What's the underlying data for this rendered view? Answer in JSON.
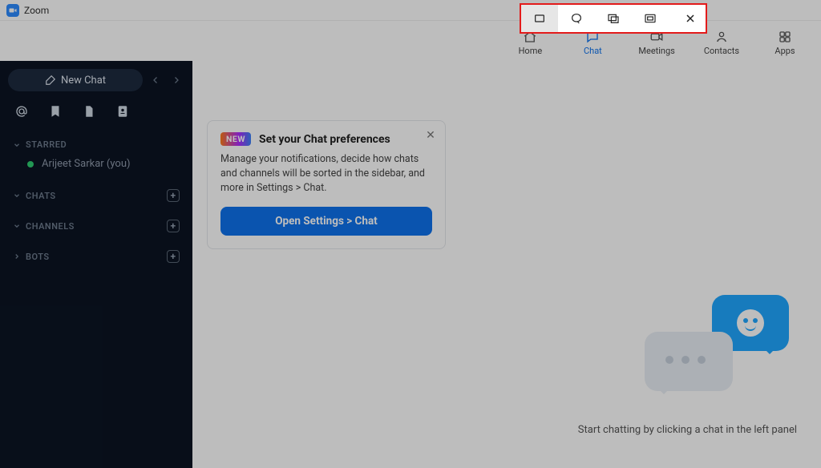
{
  "titlebar": {
    "app_name": "Zoom"
  },
  "nav": {
    "home": "Home",
    "chat": "Chat",
    "meetings": "Meetings",
    "contacts": "Contacts",
    "apps": "Apps",
    "active": "chat"
  },
  "sidebar": {
    "new_chat_label": "New Chat",
    "sections": {
      "starred": {
        "label": "STARRED",
        "items": [
          {
            "name": "Arijeet Sarkar (you)",
            "presence": "online"
          }
        ]
      },
      "chats": {
        "label": "CHATS"
      },
      "channels": {
        "label": "CHANNELS"
      },
      "bots": {
        "label": "BOTS"
      }
    }
  },
  "pref_card": {
    "badge": "NEW",
    "title": "Set your Chat preferences",
    "body": "Manage your notifications, decide how chats and channels will be sorted in the sidebar, and more in Settings > Chat.",
    "button": "Open Settings > Chat"
  },
  "empty_state": {
    "text": "Start chatting by clicking a chat in the left panel"
  },
  "snip_toolbar": {
    "mode_rect": "rectangular-snip",
    "mode_freeform": "freeform-snip",
    "mode_window": "window-snip",
    "mode_fullscreen": "fullscreen-snip",
    "close": "close-snip"
  }
}
